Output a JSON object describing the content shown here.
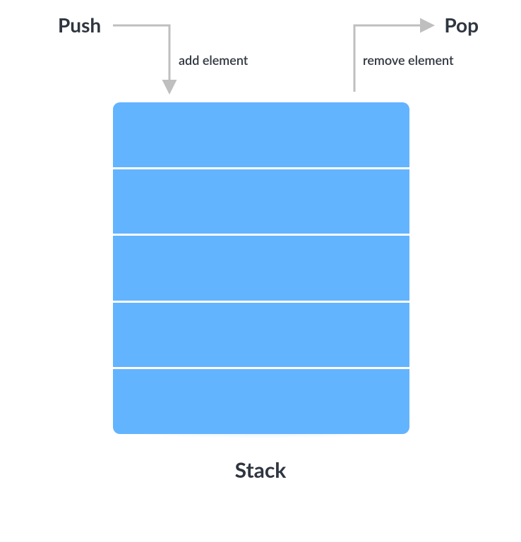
{
  "labels": {
    "push": "Push",
    "pop": "Pop",
    "add": "add element",
    "remove": "remove element",
    "title": "Stack"
  },
  "stack": {
    "cell_count": 5,
    "cell_color": "#63b4ff",
    "divider_color": "#ffffff"
  },
  "arrow": {
    "color": "#bfbfbf",
    "stroke_width": 3
  }
}
